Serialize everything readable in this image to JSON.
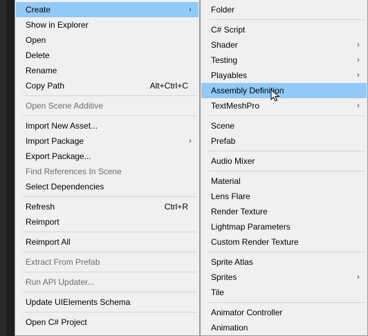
{
  "menu_left": {
    "items": [
      {
        "label": "Create",
        "shortcut": "",
        "submenu": true,
        "disabled": false,
        "highlighted": true
      },
      {
        "label": "Show in Explorer",
        "shortcut": "",
        "submenu": false,
        "disabled": false
      },
      {
        "label": "Open",
        "shortcut": "",
        "submenu": false,
        "disabled": false
      },
      {
        "label": "Delete",
        "shortcut": "",
        "submenu": false,
        "disabled": false
      },
      {
        "label": "Rename",
        "shortcut": "",
        "submenu": false,
        "disabled": false
      },
      {
        "label": "Copy Path",
        "shortcut": "Alt+Ctrl+C",
        "submenu": false,
        "disabled": false
      },
      {
        "label": "Open Scene Additive",
        "shortcut": "",
        "submenu": false,
        "disabled": true
      },
      {
        "label": "Import New Asset...",
        "shortcut": "",
        "submenu": false,
        "disabled": false
      },
      {
        "label": "Import Package",
        "shortcut": "",
        "submenu": true,
        "disabled": false
      },
      {
        "label": "Export Package...",
        "shortcut": "",
        "submenu": false,
        "disabled": false
      },
      {
        "label": "Find References In Scene",
        "shortcut": "",
        "submenu": false,
        "disabled": true
      },
      {
        "label": "Select Dependencies",
        "shortcut": "",
        "submenu": false,
        "disabled": false
      },
      {
        "label": "Refresh",
        "shortcut": "Ctrl+R",
        "submenu": false,
        "disabled": false
      },
      {
        "label": "Reimport",
        "shortcut": "",
        "submenu": false,
        "disabled": false
      },
      {
        "label": "Reimport All",
        "shortcut": "",
        "submenu": false,
        "disabled": false
      },
      {
        "label": "Extract From Prefab",
        "shortcut": "",
        "submenu": false,
        "disabled": true
      },
      {
        "label": "Run API Updater...",
        "shortcut": "",
        "submenu": false,
        "disabled": true
      },
      {
        "label": "Update UIElements Schema",
        "shortcut": "",
        "submenu": false,
        "disabled": false
      },
      {
        "label": "Open C# Project",
        "shortcut": "",
        "submenu": false,
        "disabled": false
      }
    ]
  },
  "menu_right": {
    "items": [
      {
        "label": "Folder",
        "submenu": false
      },
      {
        "label": "C# Script",
        "submenu": false
      },
      {
        "label": "Shader",
        "submenu": true
      },
      {
        "label": "Testing",
        "submenu": true
      },
      {
        "label": "Playables",
        "submenu": true
      },
      {
        "label": "Assembly Definition",
        "submenu": false,
        "highlighted": true
      },
      {
        "label": "TextMeshPro",
        "submenu": true
      },
      {
        "label": "Scene",
        "submenu": false
      },
      {
        "label": "Prefab",
        "submenu": false
      },
      {
        "label": "Audio Mixer",
        "submenu": false
      },
      {
        "label": "Material",
        "submenu": false
      },
      {
        "label": "Lens Flare",
        "submenu": false
      },
      {
        "label": "Render Texture",
        "submenu": false
      },
      {
        "label": "Lightmap Parameters",
        "submenu": false
      },
      {
        "label": "Custom Render Texture",
        "submenu": false
      },
      {
        "label": "Sprite Atlas",
        "submenu": false
      },
      {
        "label": "Sprites",
        "submenu": true
      },
      {
        "label": "Tile",
        "submenu": false
      },
      {
        "label": "Animator Controller",
        "submenu": false
      },
      {
        "label": "Animation",
        "submenu": false
      }
    ]
  },
  "icons": {
    "submenu_arrow": "chevron-right-icon",
    "cursor": "mouse-pointer-icon"
  },
  "colors": {
    "menu_bg": "#f0f0f0",
    "highlight": "#91c9f7",
    "disabled_text": "#6d6d6d",
    "separator": "#d5d5d5"
  }
}
